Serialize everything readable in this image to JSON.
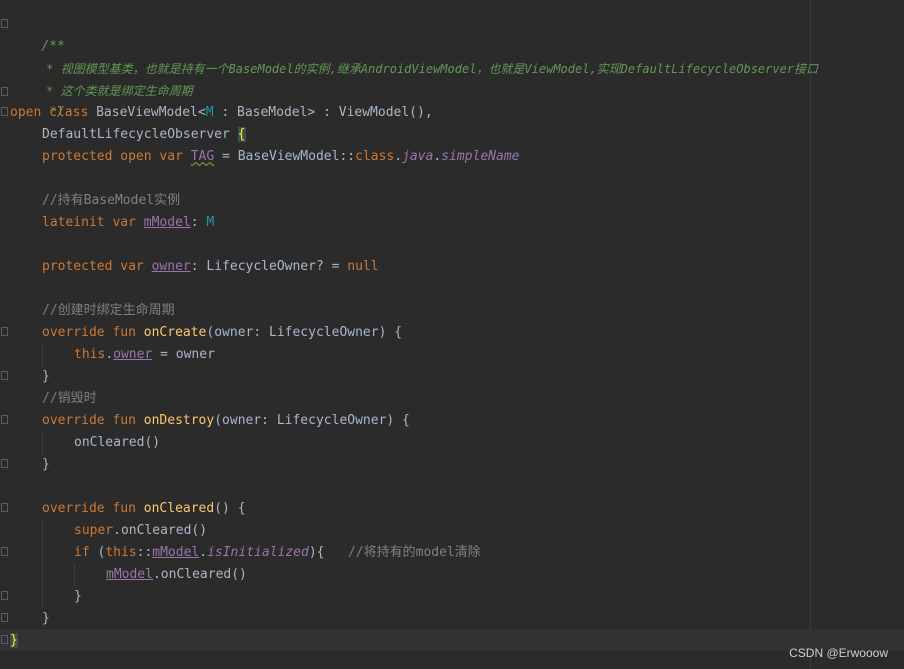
{
  "code": {
    "doc_open": "/**",
    "doc_line1": " * 视图模型基类，也就是持有一个BaseModel的实例,继承AndroidViewModel，也就是ViewModel,实现DefaultLifecycleObserver接口",
    "doc_line2": " * 这个类就是绑定生命周期",
    "doc_close": " */",
    "class_decl": {
      "kw_open": "open",
      "kw_class": "class",
      "name": "BaseViewModel<",
      "type_param": "M",
      "bound": " : BaseModel> : ViewModel(),"
    },
    "observer_line": {
      "name": "DefaultLifecycleObserver ",
      "brace": "{"
    },
    "tag_line": {
      "kw_protected": "protected",
      "kw_open": "open",
      "kw_var": "var",
      "name": "TAG",
      "assign": " = BaseViewModel::",
      "kw_class": "class",
      "dot1": ".",
      "java": "java",
      "dot2": ".",
      "simple_name": "simpleName"
    },
    "comment_model": "//持有BaseModel实例",
    "model_line": {
      "kw_lateinit": "lateinit",
      "kw_var": "var",
      "name": "mModel",
      "colon": ": ",
      "type": "M"
    },
    "owner_line": {
      "kw_protected": "protected",
      "kw_var": "var",
      "name": "owner",
      "type": ": LifecycleOwner? = ",
      "kw_null": "null"
    },
    "comment_create": "//创建时绑定生命周期",
    "oncreate_line": {
      "kw_override": "override",
      "kw_fun": "fun",
      "name": "onCreate",
      "params": "(owner: LifecycleOwner) {"
    },
    "assign_line": {
      "kw_this": "this",
      "dot": ".",
      "name": "owner",
      "rest": " = owner"
    },
    "close_brace": "}",
    "comment_destroy": "//销毁时",
    "ondestroy_line": {
      "kw_override": "override",
      "kw_fun": "fun",
      "name": "onDestroy",
      "params": "(owner: LifecycleOwner) {"
    },
    "call_oncleared": "onCleared()",
    "oncleared_line": {
      "kw_override": "override",
      "kw_fun": "fun",
      "name": "onCleared",
      "params": "() {"
    },
    "super_line": {
      "kw_super": "super",
      "rest": ".onCleared()"
    },
    "if_line": {
      "kw_if": "if",
      "open": " (",
      "kw_this": "this",
      "sep": "::",
      "name": "mModel",
      "dot": ".",
      "initialized": "isInitialized",
      "close": "){   ",
      "comment": "//将持有的model清除"
    },
    "model_call_line": {
      "name": "mModel",
      "rest": ".onCleared()"
    },
    "final_brace": "}"
  },
  "watermark": "CSDN @Erwooow",
  "colors": {
    "background": "#2b2b2b",
    "keyword": "#cc7832",
    "identifier": "#a9b7c6",
    "property": "#9876aa",
    "function": "#ffc66d",
    "type_param": "#20999d",
    "comment": "#808080",
    "doc_comment": "#629755"
  }
}
